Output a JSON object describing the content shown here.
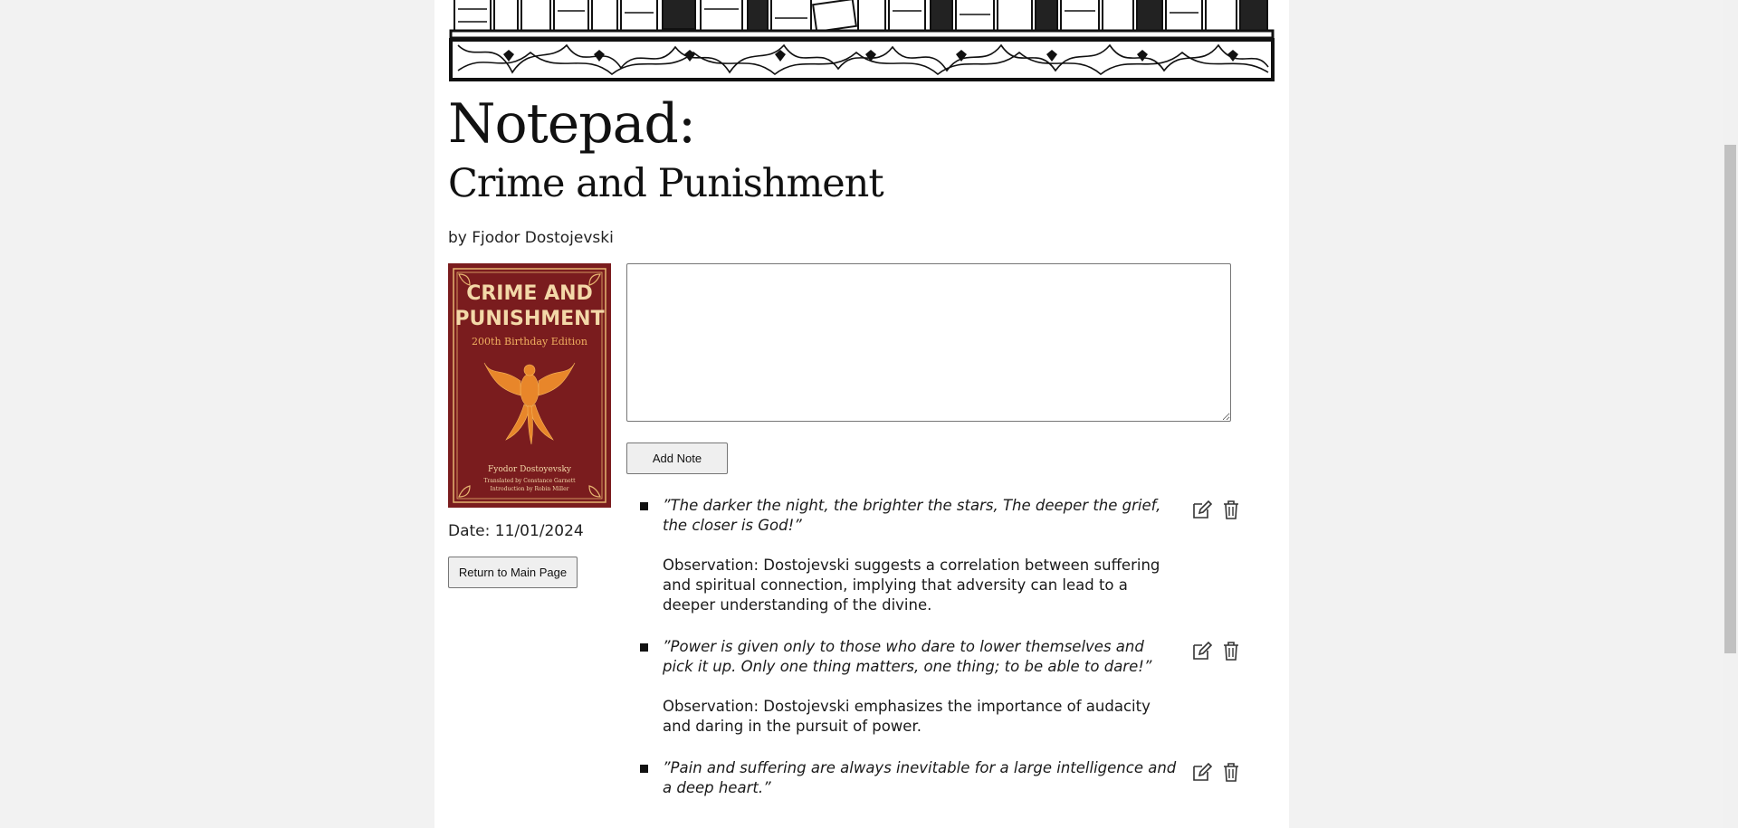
{
  "page": {
    "title": "Notepad:",
    "book_title": "Crime and Punishment",
    "author_line": "by Fjodor Dostojevski",
    "date_line": "Date: 11/01/2024"
  },
  "cover": {
    "title_line1": "CRIME AND",
    "title_line2": "PUNISHMENT",
    "edition": "200th Birthday Edition",
    "author": "Fyodor Dostoyevsky",
    "translator": "Translated by Constance Garnett",
    "intro": "Introduction by Robin Miller",
    "bg_color": "#7a1c1e",
    "text_color": "#f3d8a8"
  },
  "buttons": {
    "return_label": "Return to Main Page",
    "add_label": "Add Note"
  },
  "note_input": {
    "value": ""
  },
  "notes": [
    {
      "quote": "”The darker the night, the brighter the stars, The deeper the grief, the closer is God!”",
      "observation": "Observation: Dostojevski suggests a correlation between suffering and spiritual connection, implying that adversity can lead to a deeper understanding of the divine."
    },
    {
      "quote": "”Power is given only to those who dare to lower themselves and pick it up. Only one thing matters, one thing; to be able to dare!”",
      "observation": "Observation: Dostojevski emphasizes the importance of audacity and daring in the pursuit of power."
    },
    {
      "quote": "”Pain and suffering are always inevitable for a large intelligence and a deep heart.”",
      "observation": ""
    }
  ],
  "icons": {
    "edit": "edit-pencil-icon",
    "delete": "trash-icon"
  }
}
